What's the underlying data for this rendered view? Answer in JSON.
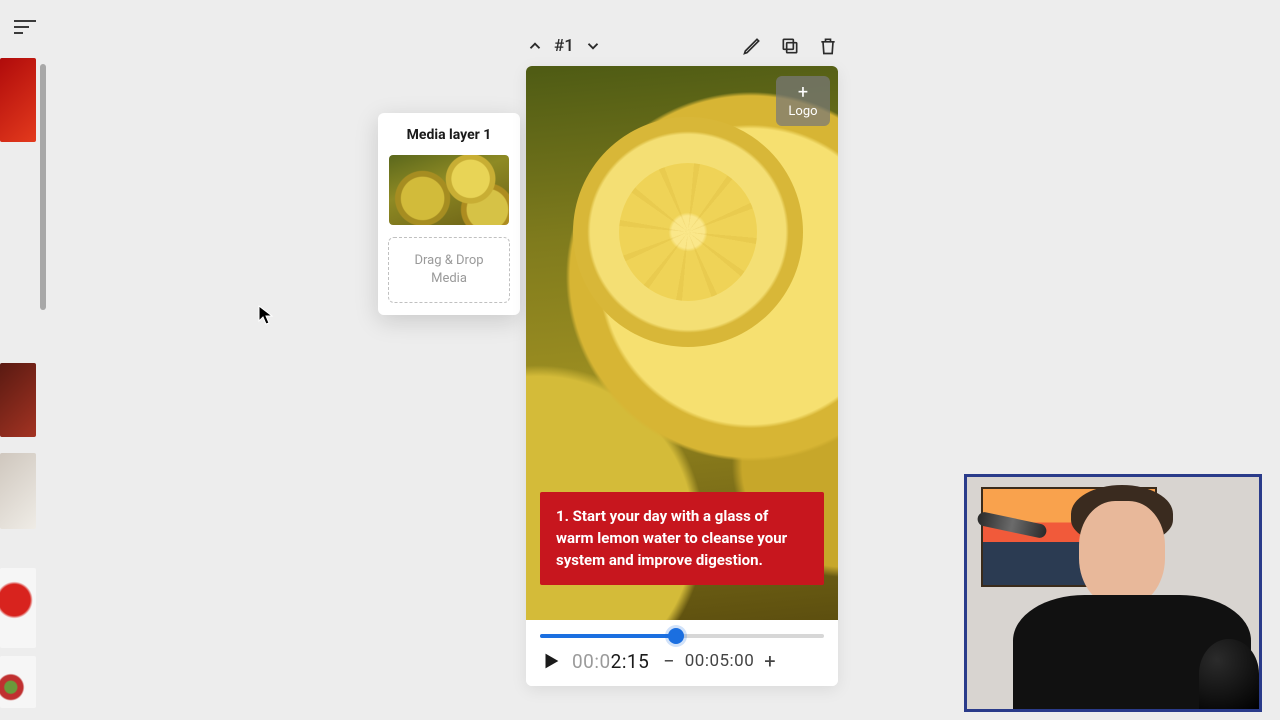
{
  "menu": {
    "aria": "menu"
  },
  "rail": {
    "scrollbar": true
  },
  "cursor": {
    "glyph": "➤"
  },
  "layer_panel": {
    "title": "Media layer 1",
    "dropzone_line1": "Drag & Drop",
    "dropzone_line2": "Media"
  },
  "toolbar": {
    "scene_label": "#1",
    "edit": "edit",
    "duplicate": "duplicate",
    "delete": "delete"
  },
  "canvas": {
    "logo_chip": {
      "plus": "+",
      "label": "Logo"
    },
    "caption": "1. Start your day with a glass of warm lemon water to cleanse your system and improve digestion."
  },
  "player": {
    "progress_percent": 48,
    "current_dim": "00:0",
    "current_bright": "2:15",
    "separator": "—",
    "total": "00:05:00",
    "minus": "−",
    "plus": "+"
  },
  "colors": {
    "accent_blue": "#1b6fe0",
    "caption_red": "#c7161e",
    "pip_border": "#2a3b8a"
  }
}
